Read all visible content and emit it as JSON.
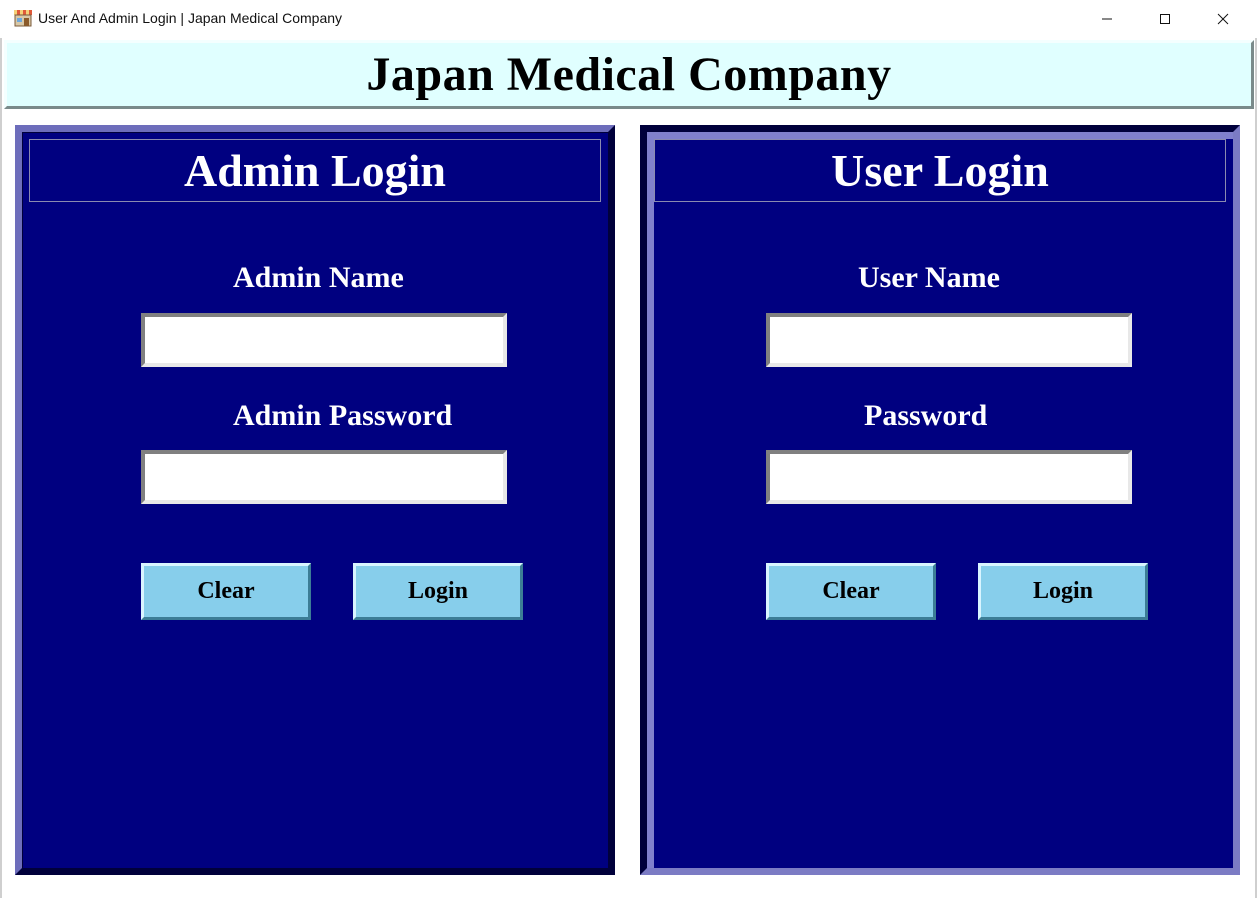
{
  "window": {
    "title": "User And Admin Login | Japan Medical Company",
    "icon": "store-icon",
    "controls": [
      "minimize-icon",
      "maximize-icon",
      "close-icon"
    ]
  },
  "header": {
    "title": "Japan Medical Company"
  },
  "admin_panel": {
    "heading": "Admin Login",
    "name_label": "Admin Name",
    "name_value": "",
    "password_label": "Admin Password",
    "password_value": "",
    "clear_label": "Clear",
    "login_label": "Login"
  },
  "user_panel": {
    "heading": "User Login",
    "name_label": "User Name",
    "name_value": "",
    "password_label": "Password",
    "password_value": "",
    "clear_label": "Clear",
    "login_label": "Login"
  },
  "colors": {
    "header_bg": "#e0ffff",
    "panel_bg": "#000080",
    "button_bg": "#87ceeb",
    "label_text": "#ffffff"
  }
}
